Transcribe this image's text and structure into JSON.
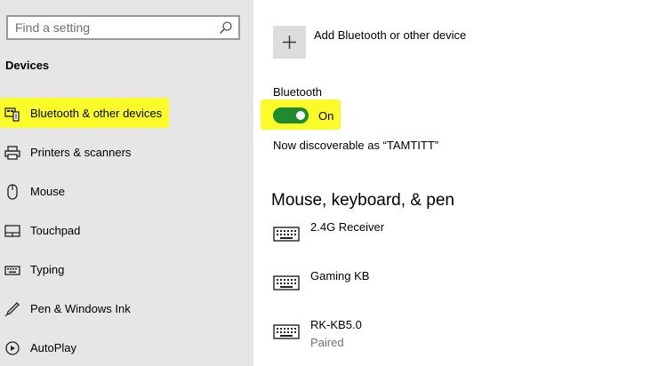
{
  "search": {
    "placeholder": "Find a setting"
  },
  "sidebar": {
    "section_title": "Devices",
    "items": [
      {
        "label": "Bluetooth & other devices",
        "icon": "bluetooth-devices-icon"
      },
      {
        "label": "Printers & scanners",
        "icon": "printer-icon"
      },
      {
        "label": "Mouse",
        "icon": "mouse-icon"
      },
      {
        "label": "Touchpad",
        "icon": "touchpad-icon"
      },
      {
        "label": "Typing",
        "icon": "keyboard-icon"
      },
      {
        "label": "Pen & Windows Ink",
        "icon": "pen-icon"
      },
      {
        "label": "AutoPlay",
        "icon": "autoplay-icon"
      }
    ]
  },
  "main": {
    "add_device_label": "Add Bluetooth or other device",
    "bluetooth": {
      "title": "Bluetooth",
      "state": "On",
      "discoverable_text": "Now discoverable as “TAMTITT”"
    },
    "devices_heading": "Mouse, keyboard, & pen",
    "devices": [
      {
        "name": "2.4G Receiver",
        "status": ""
      },
      {
        "name": "Gaming KB",
        "status": ""
      },
      {
        "name": "RK-KB5.0",
        "status": "Paired"
      }
    ]
  },
  "colors": {
    "highlight": "#fbfb2a",
    "toggle_on": "#1e8b2e",
    "sidebar_bg": "#e6e6e6"
  }
}
